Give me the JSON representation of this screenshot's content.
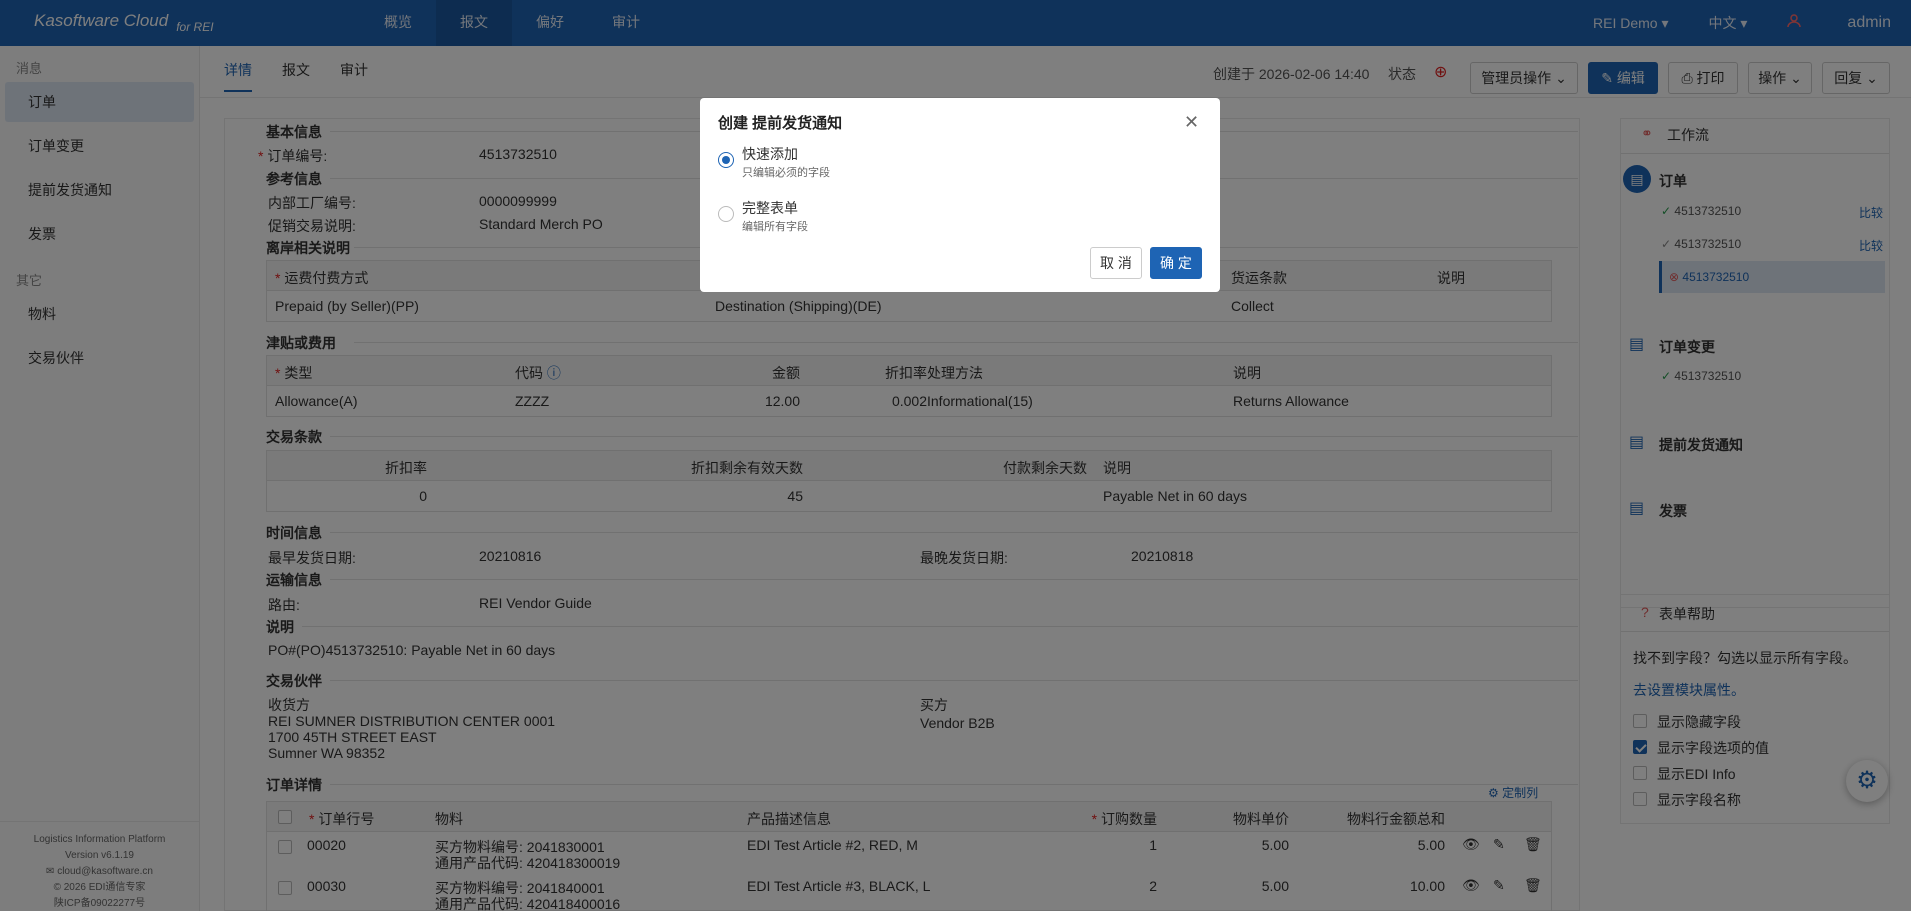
{
  "topbar": {
    "brand": "Kasoftware Cloud",
    "brand_sub": "for REI",
    "nav": [
      "概览",
      "报文",
      "偏好",
      "审计"
    ],
    "org": "REI Demo ▾",
    "lang": "中文 ▾",
    "user": "admin"
  },
  "sidebar": {
    "group1": "消息",
    "items1": [
      "订单",
      "订单变更",
      "提前发货通知",
      "发票"
    ],
    "group2": "其它",
    "items2": [
      "物料",
      "交易伙伴"
    ],
    "footer": [
      "Logistics Information Platform",
      "Version v6.1.19",
      "cloud@kasoftware.cn",
      "© 2026 EDI通信专家",
      "陕ICP备09022277号"
    ]
  },
  "tabs": [
    "详情",
    "报文",
    "审计"
  ],
  "header": {
    "created": "创建于 2026-02-06 14:40",
    "status_label": "状态",
    "admin_ops": "管理员操作 ⌄",
    "edit": "编辑",
    "print": "打印",
    "ops": "操作 ⌄",
    "reply": "回复 ⌄"
  },
  "detail": {
    "basic": "基本信息",
    "order_no_label": "订单编号:",
    "order_no": "4513732510",
    "ref": "参考信息",
    "plant_label": "内部工厂编号:",
    "plant": "0000099999",
    "promo_label": "促销交易说明:",
    "promo": "Standard Merch PO",
    "fob": "离岸相关说明",
    "fob_headers": [
      "运费付费方式",
      "",
      "货运条款",
      "说明"
    ],
    "fob_row": [
      "Prepaid (by Seller)(PP)",
      "Destination (Shipping)(DE)",
      "Collect",
      ""
    ],
    "allow": "津贴或费用",
    "allow_headers": [
      "类型",
      "代码",
      "金额",
      "折扣率",
      "处理方法",
      "说明"
    ],
    "allow_row": [
      "Allowance(A)",
      "ZZZZ",
      "12.00",
      "0.002",
      "Informational(15)",
      "Returns Allowance"
    ],
    "terms": "交易条款",
    "terms_headers": [
      "折扣率",
      "折扣剩余有效天数",
      "付款剩余天数",
      "说明"
    ],
    "terms_row": [
      "0",
      "45",
      "",
      "Payable Net in 60 days"
    ],
    "time": "时间信息",
    "earliest_label": "最早发货日期:",
    "earliest": "20210816",
    "latest_label": "最晚发货日期:",
    "latest": "20210818",
    "ship": "运输信息",
    "route_label": "路由:",
    "route": "REI Vendor Guide",
    "note": "说明",
    "note_text": "PO#(PO)4513732510: Payable Net in 60 days",
    "partner": "交易伙伴",
    "shipto_label": "收货方",
    "shipto": [
      "REI SUMNER DISTRIBUTION CENTER 0001",
      "1700 45TH STREET EAST",
      "Sumner WA 98352"
    ],
    "buyer_label": "买方",
    "buyer": "Vendor B2B",
    "lines": "订单详情",
    "customize": "定制列",
    "line_headers": [
      "订单行号",
      "物料",
      "产品描述信息",
      "订购数量",
      "物料单价",
      "物料行金额总和"
    ],
    "line_rows": [
      {
        "no": "00020",
        "mat1": "买方物料编号: 2041830001",
        "mat2": "通用产品代码: 420418300019",
        "desc": "EDI Test Article #2, RED, M",
        "qty": "1",
        "price": "5.00",
        "total": "5.00"
      },
      {
        "no": "00030",
        "mat1": "买方物料编号: 2041840001",
        "mat2": "通用产品代码: 420418400016",
        "desc": "EDI Test Article #3, BLACK, L",
        "qty": "2",
        "price": "5.00",
        "total": "10.00"
      }
    ]
  },
  "workflow": {
    "title": "工作流",
    "order": "订单",
    "order_items": [
      "4513732510",
      "4513732510",
      "4513732510"
    ],
    "compare": "比较",
    "change": "订单变更",
    "change_items": [
      "4513732510"
    ],
    "asn": "提前发货通知",
    "invoice": "发票"
  },
  "help": {
    "title": "表单帮助",
    "text": "找不到字段？勾选以显示所有字段。",
    "link": "去设置模块属性。",
    "options": [
      "显示隐藏字段",
      "显示字段选项的值",
      "显示EDI Info",
      "显示字段名称"
    ]
  },
  "modal": {
    "title": "创建 提前发货通知",
    "opt1_title": "快速添加",
    "opt1_sub": "只编辑必须的字段",
    "opt2_title": "完整表单",
    "opt2_sub": "编辑所有字段",
    "cancel": "取 消",
    "ok": "确 定"
  }
}
